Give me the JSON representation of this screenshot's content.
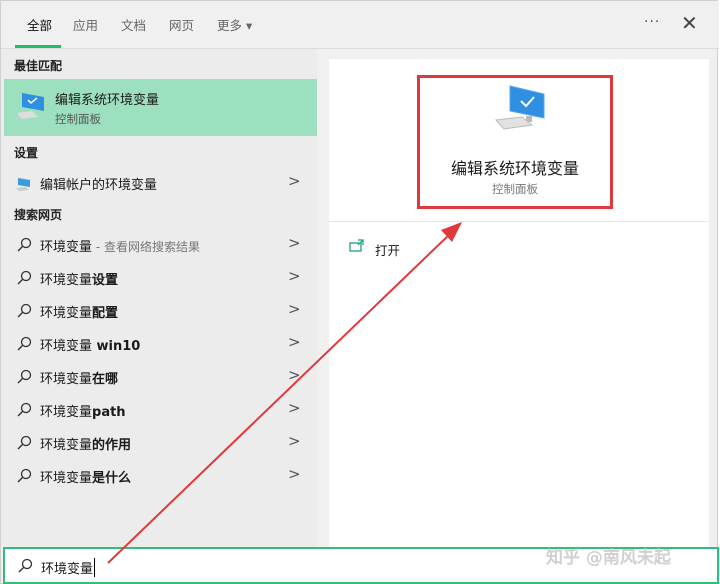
{
  "tabs": [
    {
      "label": "全部",
      "active": true
    },
    {
      "label": "应用"
    },
    {
      "label": "文档"
    },
    {
      "label": "网页"
    },
    {
      "label": "更多 ▾"
    }
  ],
  "toolbar": {
    "more": "···",
    "close": "✕"
  },
  "best_match": {
    "header": "最佳匹配",
    "title": "编辑系统环境变量",
    "subtitle": "控制面板"
  },
  "settings": {
    "header": "设置",
    "items": [
      {
        "label": "编辑帐户的环境变量"
      }
    ]
  },
  "web": {
    "header": "搜索网页",
    "items": [
      {
        "base": "环境变量",
        "bold": "",
        "sub": " - 查看网络搜索结果"
      },
      {
        "base": "环境变量",
        "bold": "设置",
        "sub": ""
      },
      {
        "base": "环境变量",
        "bold": "配置",
        "sub": ""
      },
      {
        "base": "环境变量",
        "bold": " win10",
        "sub": ""
      },
      {
        "base": "环境变量",
        "bold": "在哪",
        "sub": ""
      },
      {
        "base": "环境变量",
        "bold": "path",
        "sub": ""
      },
      {
        "base": "环境变量",
        "bold": "的作用",
        "sub": ""
      },
      {
        "base": "环境变量",
        "bold": "是什么",
        "sub": ""
      }
    ]
  },
  "preview": {
    "title": "编辑系统环境变量",
    "subtitle": "控制面板",
    "open_label": "打开"
  },
  "search": {
    "value": "环境变量"
  },
  "watermark": "知乎 @南风未起",
  "colors": {
    "accent": "#1fbf6a",
    "highlight": "#9de0c0",
    "annotation": "#e0393b"
  }
}
